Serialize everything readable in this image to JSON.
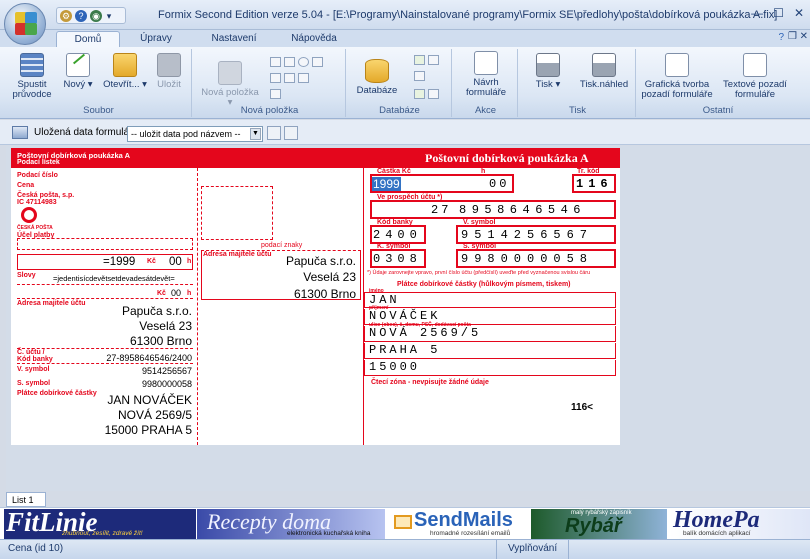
{
  "window": {
    "title": "Formix Second Edition verze 5.04 - [E:\\Programy\\Nainstalované programy\\Formix SE\\předlohy\\pošta\\dobírková poukázka A.fix]"
  },
  "tabs": [
    "Domů",
    "Úpravy",
    "Nastavení",
    "Nápověda"
  ],
  "ribbon": {
    "soubor": {
      "label": "Soubor",
      "spustit": "Spustit\nprůvodce",
      "novy": "Nový",
      "otevrit": "Otevřít...",
      "ulozit": "Uložit"
    },
    "nova_polozka": {
      "label": "Nová položka",
      "button": "Nová položka"
    },
    "databaze": {
      "label": "Databáze",
      "button": "Databáze"
    },
    "akce": {
      "label": "Akce",
      "button": "Návrh\nformuláře"
    },
    "tisk": {
      "label": "Tisk",
      "tisk": "Tisk",
      "nahled": "Tisk.náhled"
    },
    "ostatni": {
      "label": "Ostatní",
      "graficka": "Grafická tvorba\npozadí formuláře",
      "textove": "Textové pozadí\nformuláře"
    }
  },
  "toolbar2": {
    "label": "Uložená data formuláře",
    "select": "-- uložit data pod názvem --"
  },
  "form": {
    "header_left": "Poštovní dobírková poukázka A",
    "header_left2": "Podací lístek",
    "header_right": "Poštovní dobírková poukázka A",
    "labels": {
      "podaci_cislo": "Podací číslo",
      "cena": "Cena",
      "ceska_posta": "Česká pošta, s.p.",
      "ic": "IC 47114983",
      "ceska_posta_logo": "ČESKÁ POŠTA",
      "ucel": "Účel platby",
      "kc": "Kč",
      "h": "h",
      "slovy": "Slovy",
      "adresa": "Adresa majitele účtu",
      "c_uctu": "Č. účtu /\nKód banky",
      "v_symbol": "V. symbol",
      "s_symbol": "S. symbol",
      "platce": "Plátce dobírkové částky",
      "podaci_znaky": "podací znaky",
      "adresa2": "Adresa majitele účtu",
      "castka": "Částka Kč",
      "h2": "h",
      "tr_kod": "Tr. kód",
      "ve_prospech": "Ve prospěch účtu *)",
      "kod_banky": "Kód banky",
      "v_symbol2": "V. symbol",
      "k_symbol": "K. symbol",
      "s_symbol2": "S. symbol",
      "note": "*) Údaje zarovnejte vpravo, první číslo účtu (předčíslí) uveďte před vyznačenou svislou čáru",
      "platce2": "Plátce dobírkové částky (hůlkovým písmem, tiskem)",
      "jmeno": "jméno",
      "prijmeni": "příjmení",
      "ulice": "ulice (obec), č. domu, PSČ, dodávací pošta",
      "cteci": "Čtecí zóna - nevpisujte žádné údaje"
    },
    "values": {
      "cena": "=1999",
      "cena_h": "00",
      "slovy": "=jedentisícdevětsetdevadesátdevět=",
      "h_left": "00",
      "adr1": "Papuča s.r.o.",
      "adr2": "Veselá 23",
      "adr3": "61300 Brno",
      "ucet": "27-8958646546/2400",
      "vsym": "9514256567",
      "ssym": "9980000058",
      "pl1": "JAN NOVÁČEK",
      "pl2": "NOVÁ 2569/5",
      "pl3": "15000 PRAHA 5",
      "mid1": "Papuča s.r.o.",
      "mid2": "Veselá 23",
      "mid3": "61300 Brno",
      "castka": "1999",
      "castka_h": "00",
      "tr_kod": "116",
      "ucet_pref": "27",
      "ucet_num": "8958646546",
      "kod_banky": "2400",
      "vsym2": "9514256567",
      "ksym": "0308",
      "ssym2": "9980000058",
      "r1": "JAN",
      "r2": "NOVÁČEK",
      "r3": "NOVÁ 2569/5",
      "r4": "PRAHA 5",
      "r5": "15000",
      "code": "116<"
    }
  },
  "sheet_tab": "List 1",
  "ads": [
    "FitLinie",
    "zhubnout, zesílit, zdravě žít!",
    "Recepty doma",
    "elektronická kuchařská kniha",
    "SendMails",
    "hromadné rozesílání emailů",
    "malý rybářský zápisník",
    "Rybář",
    "HomePa",
    "balík domácích aplikací"
  ],
  "status": {
    "left": "Cena (id 10)",
    "mid": "Vyplňování"
  }
}
